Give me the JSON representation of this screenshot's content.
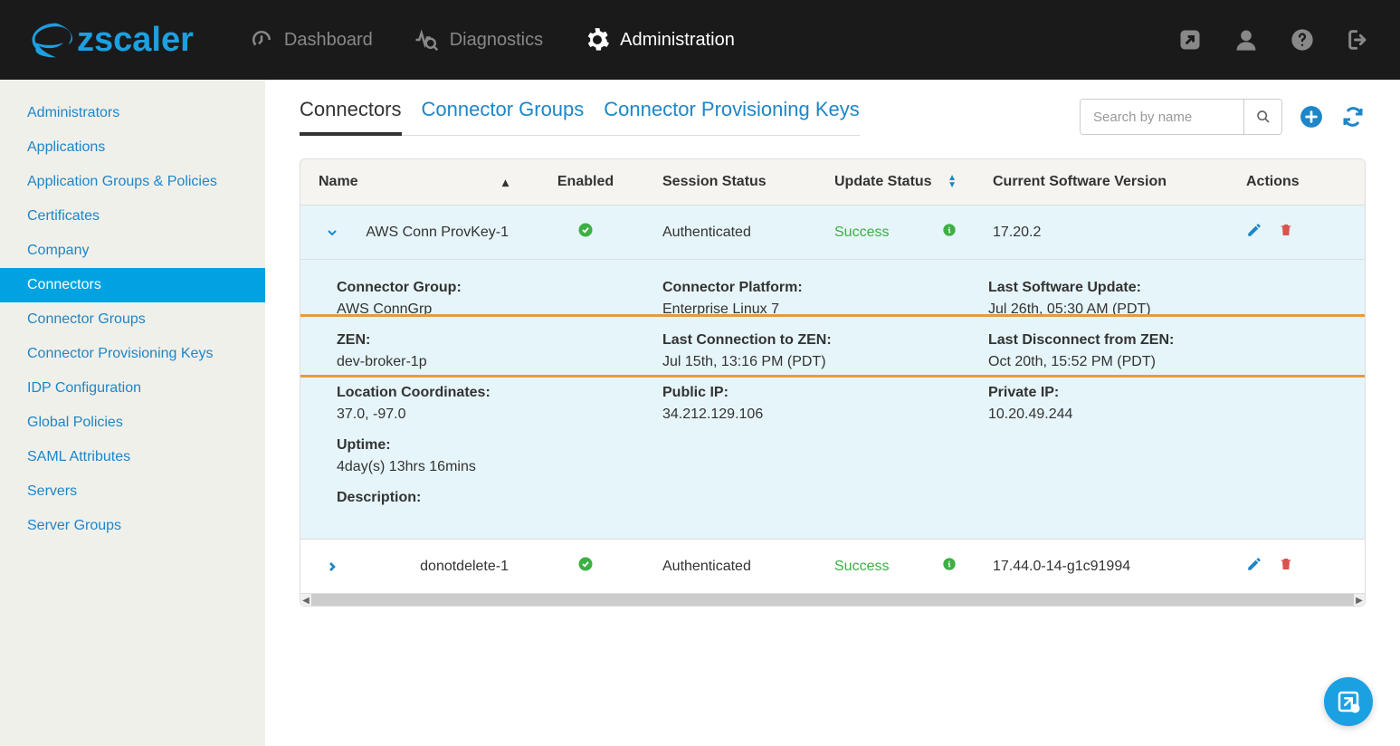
{
  "brand": "zscaler",
  "nav": {
    "dashboard": "Dashboard",
    "diagnostics": "Diagnostics",
    "administration": "Administration"
  },
  "sidebar": {
    "items": [
      {
        "label": "Administrators"
      },
      {
        "label": "Applications"
      },
      {
        "label": "Application Groups & Policies"
      },
      {
        "label": "Certificates"
      },
      {
        "label": "Company"
      },
      {
        "label": "Connectors"
      },
      {
        "label": "Connector Groups"
      },
      {
        "label": "Connector Provisioning Keys"
      },
      {
        "label": "IDP Configuration"
      },
      {
        "label": "Global Policies"
      },
      {
        "label": "SAML Attributes"
      },
      {
        "label": "Servers"
      },
      {
        "label": "Server Groups"
      }
    ],
    "activeIndex": 5
  },
  "pageTabs": {
    "items": [
      "Connectors",
      "Connector Groups",
      "Connector Provisioning Keys"
    ],
    "activeIndex": 0
  },
  "search": {
    "placeholder": "Search by name"
  },
  "columns": {
    "name": "Name",
    "enabled": "Enabled",
    "session": "Session Status",
    "update": "Update Status",
    "version": "Current Software Version",
    "actions": "Actions"
  },
  "rows": {
    "r0": {
      "name": "AWS Conn ProvKey-1",
      "session": "Authenticated",
      "update": "Success",
      "version": "17.20.2",
      "expanded": true,
      "details": {
        "connectorGroupLabel": "Connector Group:",
        "connectorGroup": "AWS ConnGrp",
        "platformLabel": "Connector Platform:",
        "platform": "Enterprise Linux 7",
        "lastUpdateLabel": "Last Software Update:",
        "lastUpdate": "Jul 26th, 05:30 AM (PDT)",
        "zenLabel": "ZEN:",
        "zen": "dev-broker-1p",
        "lastConnLabel": "Last Connection to ZEN:",
        "lastConn": "Jul 15th, 13:16 PM (PDT)",
        "lastDiscLabel": "Last Disconnect from ZEN:",
        "lastDisc": "Oct 20th, 15:52 PM (PDT)",
        "locLabel": "Location Coordinates:",
        "loc": "37.0, -97.0",
        "pubIpLabel": "Public IP:",
        "pubIp": "34.212.129.106",
        "privIpLabel": "Private IP:",
        "privIp": "10.20.49.244",
        "uptimeLabel": "Uptime:",
        "uptime": "4day(s) 13hrs 16mins",
        "descLabel": "Description:",
        "desc": ""
      }
    },
    "r1": {
      "name": "donotdelete-1",
      "session": "Authenticated",
      "update": "Success",
      "version": "17.44.0-14-g1c91994",
      "expanded": false
    }
  }
}
